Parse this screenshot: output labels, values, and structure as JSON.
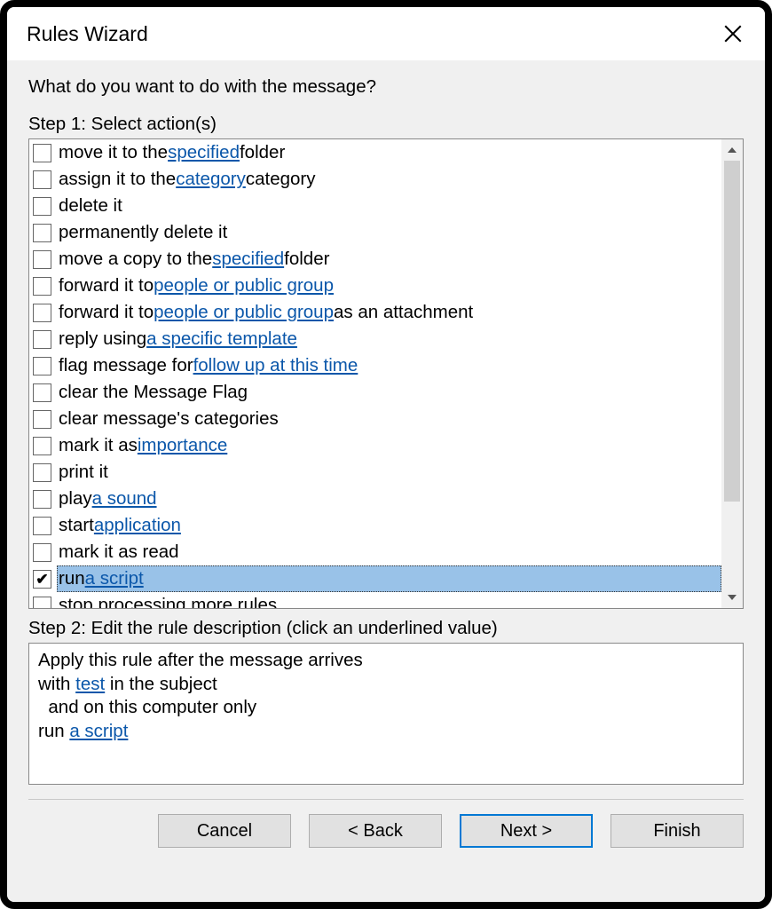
{
  "window": {
    "title": "Rules Wizard"
  },
  "prompt": "What do you want to do with the message?",
  "step1_label": "Step 1: Select action(s)",
  "step2_label": "Step 2: Edit the rule description (click an underlined value)",
  "actions": [
    {
      "checked": false,
      "selected": false,
      "parts": [
        {
          "t": "move it to the "
        },
        {
          "t": "specified",
          "link": true
        },
        {
          "t": " folder"
        }
      ]
    },
    {
      "checked": false,
      "selected": false,
      "parts": [
        {
          "t": "assign it to the "
        },
        {
          "t": "category",
          "link": true
        },
        {
          "t": " category"
        }
      ]
    },
    {
      "checked": false,
      "selected": false,
      "parts": [
        {
          "t": "delete it"
        }
      ]
    },
    {
      "checked": false,
      "selected": false,
      "parts": [
        {
          "t": "permanently delete it"
        }
      ]
    },
    {
      "checked": false,
      "selected": false,
      "parts": [
        {
          "t": "move a copy to the "
        },
        {
          "t": "specified",
          "link": true
        },
        {
          "t": " folder"
        }
      ]
    },
    {
      "checked": false,
      "selected": false,
      "parts": [
        {
          "t": "forward it to "
        },
        {
          "t": "people or public group",
          "link": true
        }
      ]
    },
    {
      "checked": false,
      "selected": false,
      "parts": [
        {
          "t": "forward it to "
        },
        {
          "t": "people or public group",
          "link": true
        },
        {
          "t": " as an attachment"
        }
      ]
    },
    {
      "checked": false,
      "selected": false,
      "parts": [
        {
          "t": "reply using "
        },
        {
          "t": "a specific template",
          "link": true
        }
      ]
    },
    {
      "checked": false,
      "selected": false,
      "parts": [
        {
          "t": "flag message for "
        },
        {
          "t": "follow up at this time",
          "link": true
        }
      ]
    },
    {
      "checked": false,
      "selected": false,
      "parts": [
        {
          "t": "clear the Message Flag"
        }
      ]
    },
    {
      "checked": false,
      "selected": false,
      "parts": [
        {
          "t": "clear message's categories"
        }
      ]
    },
    {
      "checked": false,
      "selected": false,
      "parts": [
        {
          "t": "mark it as "
        },
        {
          "t": "importance",
          "link": true
        }
      ]
    },
    {
      "checked": false,
      "selected": false,
      "parts": [
        {
          "t": "print it"
        }
      ]
    },
    {
      "checked": false,
      "selected": false,
      "parts": [
        {
          "t": "play "
        },
        {
          "t": "a sound",
          "link": true
        }
      ]
    },
    {
      "checked": false,
      "selected": false,
      "parts": [
        {
          "t": "start "
        },
        {
          "t": "application",
          "link": true
        }
      ]
    },
    {
      "checked": false,
      "selected": false,
      "parts": [
        {
          "t": "mark it as read"
        }
      ]
    },
    {
      "checked": true,
      "selected": true,
      "parts": [
        {
          "t": "run "
        },
        {
          "t": "a script",
          "link": true
        }
      ]
    },
    {
      "checked": false,
      "selected": false,
      "parts": [
        {
          "t": "stop processing more rules"
        }
      ]
    }
  ],
  "description_lines": [
    [
      {
        "t": "Apply this rule after the message arrives"
      }
    ],
    [
      {
        "t": "with "
      },
      {
        "t": "test",
        "link": true
      },
      {
        "t": " in the subject"
      }
    ],
    [
      {
        "t": "  and on this computer only"
      }
    ],
    [
      {
        "t": "run "
      },
      {
        "t": "a script",
        "link": true
      }
    ]
  ],
  "buttons": {
    "cancel": "Cancel",
    "back": "< Back",
    "next": "Next >",
    "finish": "Finish"
  }
}
